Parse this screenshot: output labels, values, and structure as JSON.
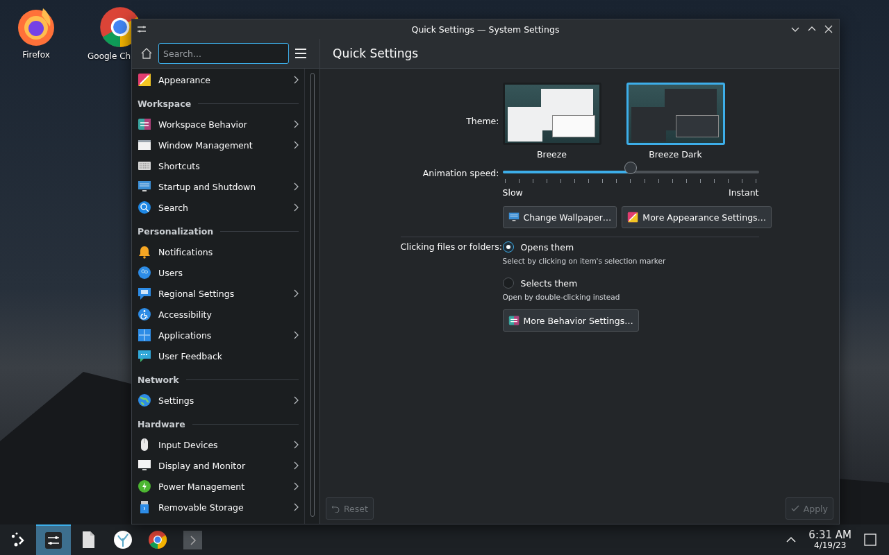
{
  "desktop_icons": [
    {
      "label": "Firefox"
    },
    {
      "label": "Google Ch"
    }
  ],
  "window": {
    "title": "Quick Settings — System Settings"
  },
  "sidebar": {
    "search": {
      "placeholder": "Search..."
    },
    "sections": [
      {
        "items": [
          {
            "label": "Appearance",
            "has_arrow": true
          }
        ]
      },
      {
        "heading": "Workspace",
        "items": [
          {
            "label": "Workspace Behavior",
            "has_arrow": true
          },
          {
            "label": "Window Management",
            "has_arrow": true
          },
          {
            "label": "Shortcuts",
            "has_arrow": false
          },
          {
            "label": "Startup and Shutdown",
            "has_arrow": true
          },
          {
            "label": "Search",
            "has_arrow": true
          }
        ]
      },
      {
        "heading": "Personalization",
        "items": [
          {
            "label": "Notifications",
            "has_arrow": false
          },
          {
            "label": "Users",
            "has_arrow": false
          },
          {
            "label": "Regional Settings",
            "has_arrow": true
          },
          {
            "label": "Accessibility",
            "has_arrow": false
          },
          {
            "label": "Applications",
            "has_arrow": true
          },
          {
            "label": "User Feedback",
            "has_arrow": false
          }
        ]
      },
      {
        "heading": "Network",
        "items": [
          {
            "label": "Settings",
            "has_arrow": true
          }
        ]
      },
      {
        "heading": "Hardware",
        "items": [
          {
            "label": "Input Devices",
            "has_arrow": true
          },
          {
            "label": "Display and Monitor",
            "has_arrow": true
          },
          {
            "label": "Power Management",
            "has_arrow": true
          },
          {
            "label": "Removable Storage",
            "has_arrow": true
          }
        ]
      }
    ]
  },
  "page": {
    "title": "Quick Settings",
    "theme": {
      "label": "Theme:",
      "options": [
        {
          "label": "Breeze",
          "selected": false
        },
        {
          "label": "Breeze Dark",
          "selected": true
        }
      ]
    },
    "animation": {
      "label": "Animation speed:",
      "level": 0.5,
      "min_label": "Slow",
      "max_label": "Instant"
    },
    "appearance_buttons": [
      "Change Wallpaper…",
      "More Appearance Settings…"
    ],
    "clicking": {
      "label": "Clicking files or folders:",
      "options": [
        {
          "label": "Opens them",
          "hint": "Select by clicking on item's selection marker",
          "selected": true
        },
        {
          "label": "Selects them",
          "hint": "Open by double-clicking instead",
          "selected": false
        }
      ]
    },
    "behavior_button": "More Behavior Settings…"
  },
  "footer": {
    "buttons": [
      {
        "label": "Reset",
        "disabled": true
      },
      {
        "label": "Apply",
        "disabled": true
      }
    ]
  },
  "taskbar": {
    "tasks": [
      {
        "selected": true
      },
      {
        "selected": false
      },
      {
        "selected": false
      },
      {
        "selected": false
      },
      {
        "selected": false
      }
    ],
    "clock": {
      "time": "6:31 AM",
      "date": "4/19/23"
    }
  }
}
